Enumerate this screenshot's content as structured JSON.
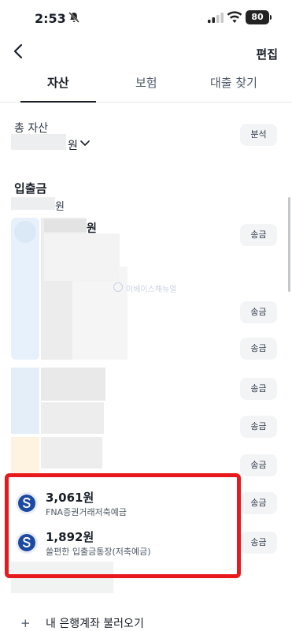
{
  "status_bar": {
    "time": "2:53",
    "battery": "80"
  },
  "nav": {
    "edit_label": "편집"
  },
  "tabs": [
    {
      "label": "자산",
      "active": true
    },
    {
      "label": "보험",
      "active": false
    },
    {
      "label": "대출 찾기",
      "active": false
    }
  ],
  "total_assets": {
    "label": "총 자산",
    "unit": "원",
    "analysis_button": "분석"
  },
  "section": {
    "title": "입출금",
    "unit": "원"
  },
  "first_account": {
    "unit": "원"
  },
  "watermark": "이베이스해뉴얼",
  "transfer_label": "송금",
  "accounts": [
    {
      "amount": "3,061원",
      "name": "FNA증권거래저축예금"
    },
    {
      "amount": "1,892원",
      "name": "쓸편한 입출금통장(저축예금)"
    }
  ],
  "bottom": {
    "add_account_icon": "+",
    "add_account_label": "내 은행계좌 불러오기"
  },
  "colors": {
    "highlight": "#e8191c",
    "text": "#191f28",
    "button_bg": "#f2f4f6",
    "bank_icon": "#1b4aa0"
  }
}
